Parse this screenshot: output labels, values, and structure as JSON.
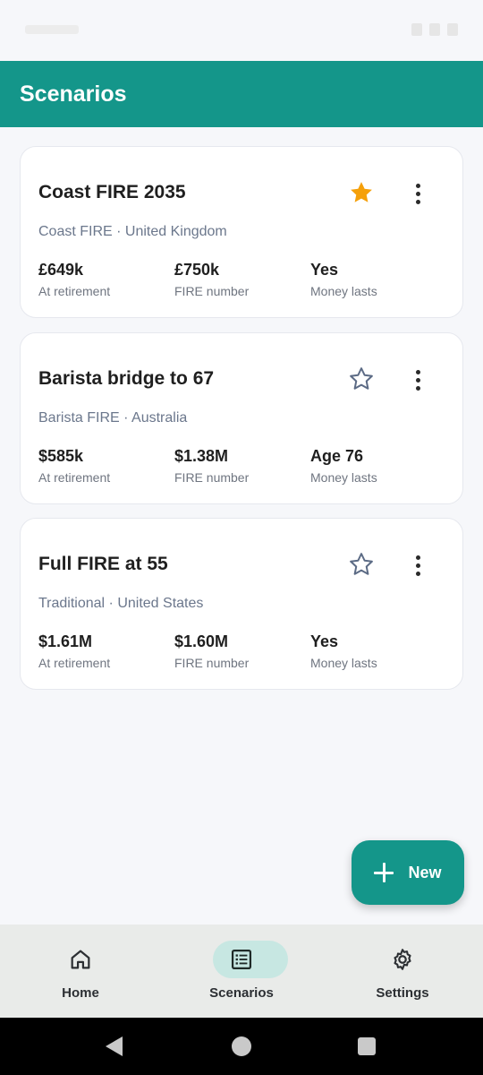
{
  "app_bar": {
    "title": "Scenarios"
  },
  "scenarios": [
    {
      "title": "Coast FIRE 2035",
      "subtitle": "Coast FIRE · United Kingdom",
      "favorite": true,
      "stats": [
        {
          "value": "£649k",
          "label": "At retirement"
        },
        {
          "value": "£750k",
          "label": "FIRE number"
        },
        {
          "value": "Yes",
          "label": "Money lasts"
        }
      ]
    },
    {
      "title": "Barista bridge to 67",
      "subtitle": "Barista FIRE · Australia",
      "favorite": false,
      "stats": [
        {
          "value": "$585k",
          "label": "At retirement"
        },
        {
          "value": "$1.38M",
          "label": "FIRE number"
        },
        {
          "value": "Age 76",
          "label": "Money lasts"
        }
      ]
    },
    {
      "title": "Full FIRE at 55",
      "subtitle": "Traditional · United States",
      "favorite": false,
      "stats": [
        {
          "value": "$1.61M",
          "label": "At retirement"
        },
        {
          "value": "$1.60M",
          "label": "FIRE number"
        },
        {
          "value": "Yes",
          "label": "Money lasts"
        }
      ]
    }
  ],
  "fab": {
    "label": "New",
    "icon": "plus-icon"
  },
  "bottom_nav": {
    "items": [
      {
        "label": "Home",
        "icon": "home-icon",
        "active": false
      },
      {
        "label": "Scenarios",
        "icon": "list-icon",
        "active": true
      },
      {
        "label": "Settings",
        "icon": "gear-icon",
        "active": false
      }
    ]
  },
  "colors": {
    "primary": "#14968a",
    "star_active": "#f5a00a",
    "star_inactive": "#5c6b85",
    "nav_active_pill": "#c7e7e2"
  }
}
